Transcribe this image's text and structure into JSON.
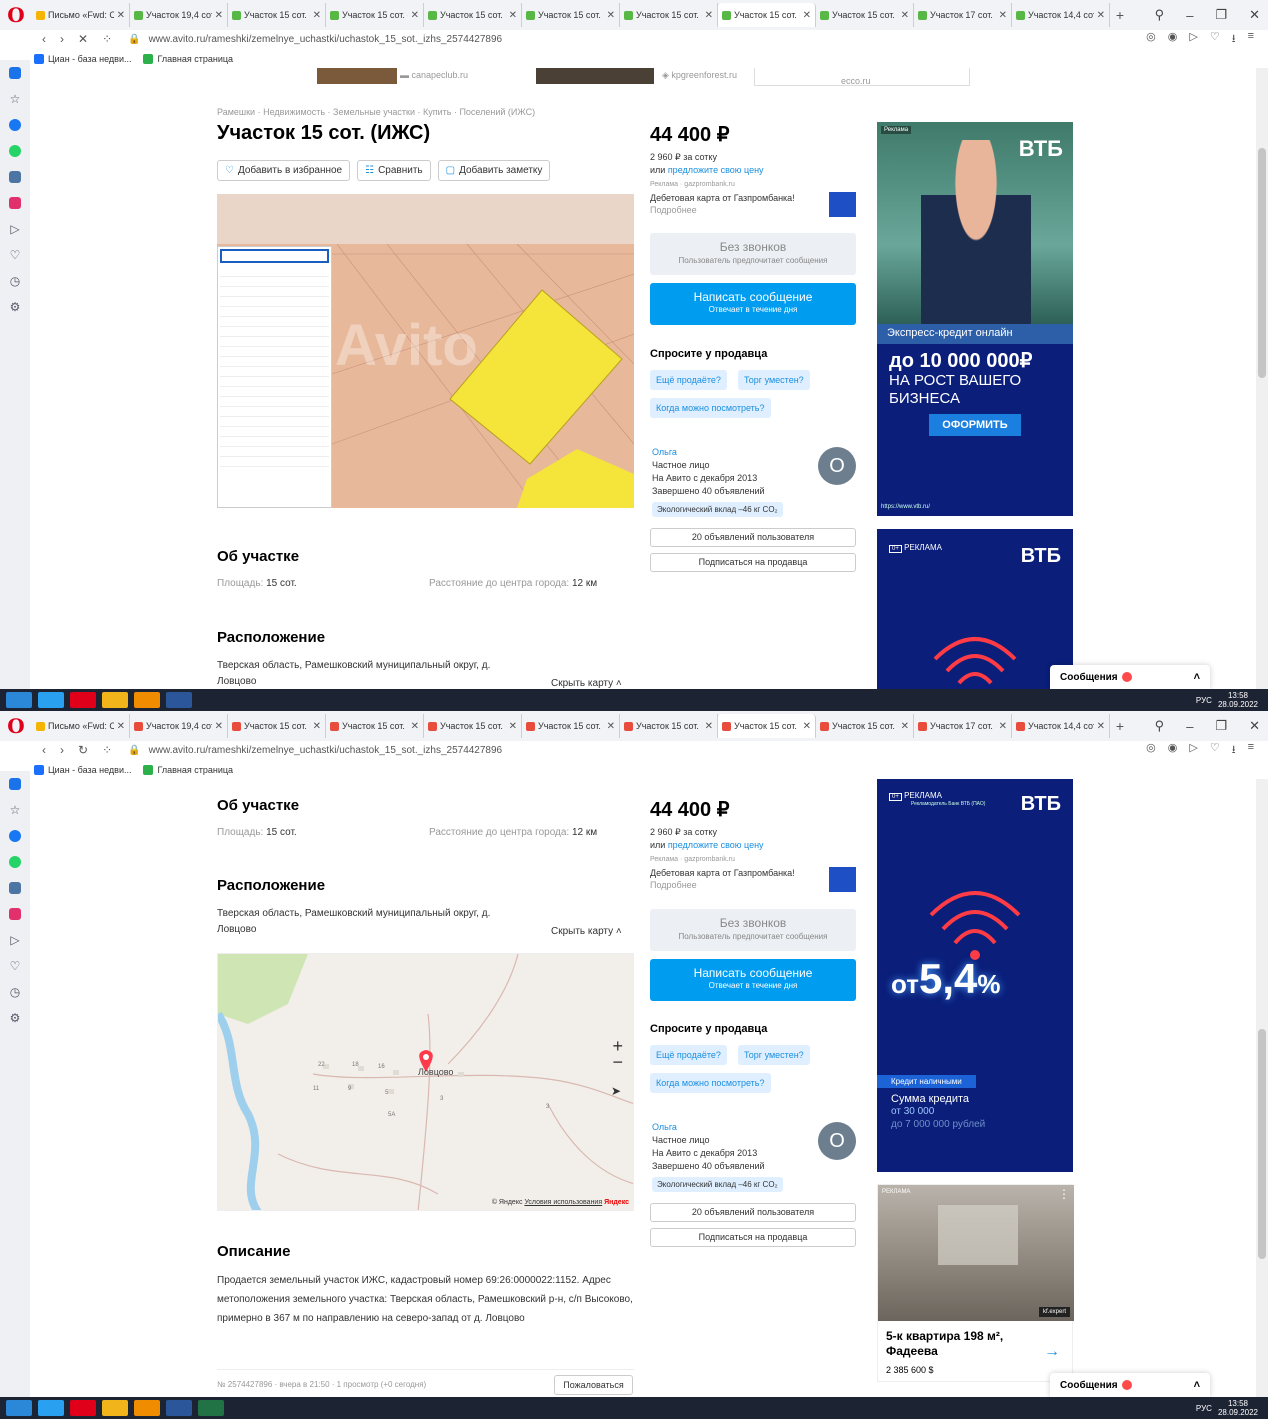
{
  "browser": {
    "tabs_top": [
      "Письмо «Fwd: Ci",
      "Участок 19,4 сот",
      "Участок 15 сот. (И",
      "Участок 15 сот. (И",
      "Участок 15 сот. (И",
      "Участок 15 сот. (И",
      "Участок 15 сот. (И",
      "Участок 15 сот. (И",
      "Участок 15 сот. (И",
      "Участок 17 сот. (И",
      "Участок 14,4 сот"
    ],
    "active_tab_index": 7,
    "url": "www.avito.ru/rameshki/zemelnye_uchastki/uchastok_15_sot._izhs_2574427896",
    "bookmarks": [
      "Циан - база недви...",
      "Главная страница"
    ]
  },
  "taskbar": {
    "lang": "РУС",
    "time": "13:58",
    "date": "28.09.2022"
  },
  "ads_strip": [
    "canapeclub.ru",
    "kpgreenforest.ru",
    "ecco.ru"
  ],
  "listing": {
    "breadcrumbs": "Рамешки · Недвижимость · Земельные участки · Купить · Поселений (ИЖС)",
    "title": "Участок 15 сот. (ИЖС)",
    "fav_button": "Добавить в избранное",
    "compare_button": "Сравнить",
    "note_button": "Добавить заметку",
    "price": "44 400 ₽",
    "price_per": "2 960 ₽ за сотку",
    "offer_prefix": "или ",
    "offer_link": "предложите свою цену",
    "ad_label": "Реклама · gazprombank.ru",
    "ad_text": "Дебетовая карта от Газпромбанка!",
    "ad_more": "Подробнее",
    "no_calls": "Без звонков",
    "no_calls_sub": "Пользователь предпочитает сообщения",
    "write": "Написать сообщение",
    "write_sub": "Отвечает в течение дня",
    "ask": "Спросите у продавца",
    "chip1": "Ещё продаёте?",
    "chip2": "Торг уместен?",
    "chip3": "Когда можно посмотреть?",
    "seller_name": "Ольга",
    "seller_type": "Частное лицо",
    "seller_since": "На Авито с декабря 2013",
    "seller_done": "Завершено 40 объявлений",
    "seller_eco": "Экологический вклад –46 кг CO₂",
    "avatar_letter": "О",
    "user_ads": "20 объявлений пользователя",
    "subscribe": "Подписаться на продавца",
    "about_title": "Об участке",
    "area_label": "Площадь:",
    "area_value": "15 сот.",
    "dist_label": "Расстояние до центра города:",
    "dist_value": "12 км",
    "loc_title": "Расположение",
    "loc_text_1": "Тверская область, Рамешковский муниципальный округ, д.",
    "loc_text_2": "Ловцово",
    "hide_map": "Скрыть карту",
    "map_village": "Ловцово",
    "map_copyright": "© Яндекс",
    "map_terms": "Условия использования",
    "map_brand": "Яндекс",
    "map_house_numbers": [
      "22",
      "18",
      "16",
      "11",
      "9",
      "5",
      "5А",
      "3",
      "3"
    ],
    "desc_title": "Описание",
    "desc_text": "Продается земельный участок ИЖС, кадастровый номер 69:26:0000022:1152. Адрес метоположения земельного участка: Тверская область, Рамешковский р-н, с/п Высоково, примерно в 367 м по направлению на северо-запад от д. Ловцово",
    "meta": "№ 2574427896 · вчера в 21:50 · 1 просмотр (+0 сегодня)",
    "report": "Пожаловаться",
    "photo_watermark": "Avito"
  },
  "ad_vtb1": {
    "badge": "Реклама",
    "logo": "ВТБ",
    "strip": "Экспресс-кредит онлайн",
    "big": "до 10 000 000₽",
    "line2": "НА РОСТ ВАШЕГО",
    "line3": "БИЗНЕСА",
    "cta": "ОФОРМИТЬ",
    "url": "https://www.vtb.ru/"
  },
  "ad_vtb2": {
    "label": "РЕКЛАМА",
    "sub": "Рекламодатель Банк ВТБ (ПАО)",
    "logo": "ВТБ",
    "rate_prefix": "от",
    "rate": "5,4",
    "rate_pct": "%",
    "tag": "Кредит наличными",
    "sum_title": "Сумма кредита",
    "sum_from": "от 30 000",
    "sum_to": "до 7 000 000 рублей"
  },
  "ad_flat": {
    "label": "РЕКЛАМА",
    "brand": "kf.expert",
    "title": "5-к квартира 198 м², Фадеева",
    "price": "2 385 600 $"
  },
  "messages": {
    "label": "Сообщения"
  },
  "colors": {
    "avito_blue": "#009cf0",
    "vtb_navy": "#0a1e7a",
    "plot_yellow": "#f5e43a",
    "land_pink": "#e8b89a"
  }
}
